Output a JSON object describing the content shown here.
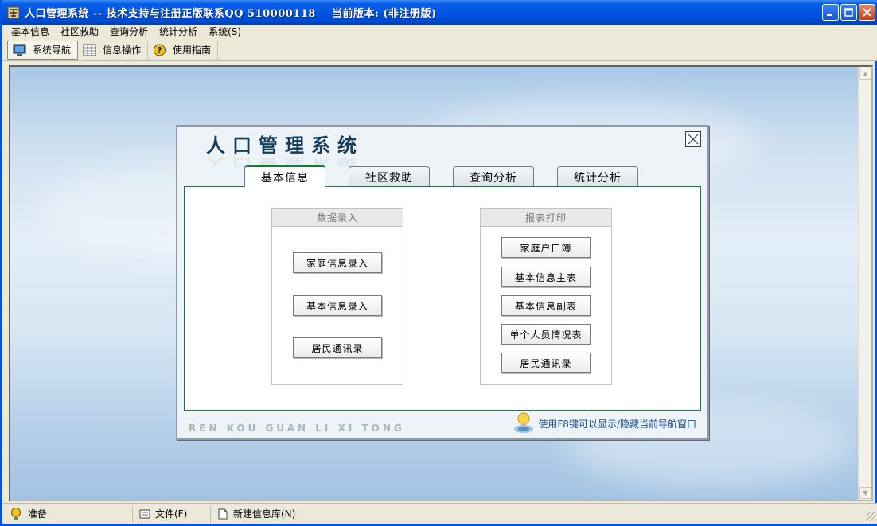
{
  "window": {
    "title": "人口管理系统 -- 技术支持与注册正版联系QQ 510000118    当前版本: (非注册版)"
  },
  "menu": [
    "基本信息",
    "社区救助",
    "查询分析",
    "统计分析",
    "系统(S)"
  ],
  "toolbar": [
    {
      "label": "系统导航",
      "icon": "monitor-icon",
      "active": true
    },
    {
      "label": "信息操作",
      "icon": "grid-icon",
      "active": false
    },
    {
      "label": "使用指南",
      "icon": "help-icon",
      "active": false
    }
  ],
  "dialog": {
    "title": "人口管理系统",
    "tabs": [
      "基本信息",
      "社区救助",
      "查询分析",
      "统计分析"
    ],
    "active_tab": "基本信息",
    "groups": {
      "entry": {
        "title": "数据录入",
        "buttons": [
          "家庭信息录入",
          "基本信息录入",
          "居民通讯录"
        ]
      },
      "print": {
        "title": "报表打印",
        "buttons": [
          "家庭户口簿",
          "基本信息主表",
          "基本信息副表",
          "单个人员情况表",
          "居民通讯录"
        ]
      }
    },
    "footer_pinyin": "REN KOU GUAN LI XI TONG",
    "hint": "使用F8键可以显示/隐藏当前导航窗口"
  },
  "status": {
    "state": "准备",
    "file": "文件(F)",
    "new_db": "新建信息库(N)"
  },
  "colors": {
    "titlebar": "#0054e3",
    "accent_green": "#1a7a3d",
    "dialog_title": "#133d5a"
  }
}
